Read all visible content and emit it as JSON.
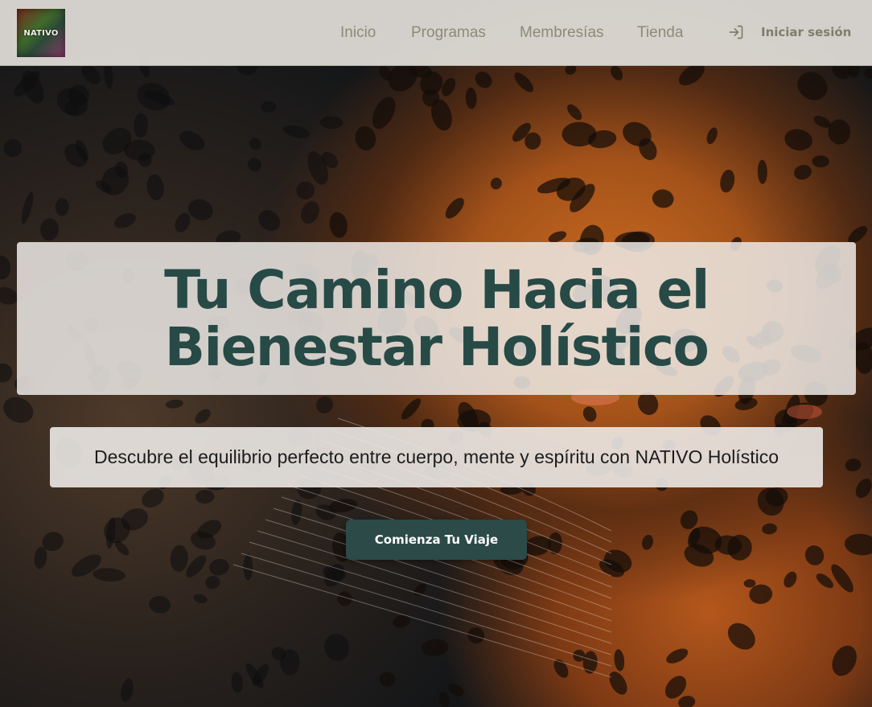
{
  "brand": {
    "logo_text": "NATIVO",
    "logo_icon": "nativo-logo"
  },
  "nav": {
    "links": [
      "Inicio",
      "Programas",
      "Membresías",
      "Tienda"
    ],
    "login_label": "Iniciar sesión",
    "login_icon": "sign-in-icon"
  },
  "hero": {
    "headline": "Tu Camino Hacia el Bienestar Holístico",
    "subtitle": "Descubre el equilibrio perfecto entre cuerpo, mente y espíritu con NATIVO Holístico",
    "cta_label": "Comienza Tu Viaje",
    "background_image": "jaguar face photograph"
  },
  "colors": {
    "headline": "#274a46",
    "cta_background": "#2b4a48",
    "nav_text": "#8c8b77",
    "nav_background": "#e2dfd9"
  }
}
